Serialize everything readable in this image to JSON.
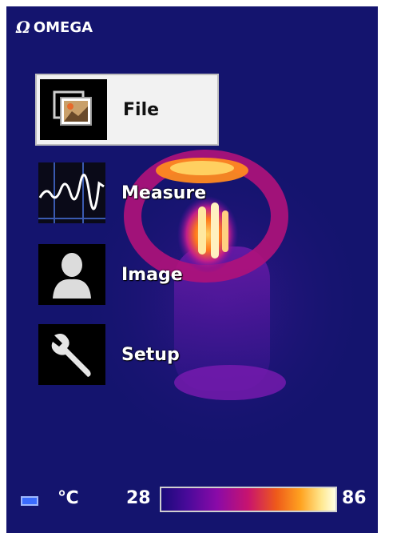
{
  "brand": {
    "symbol": "Ω",
    "name": "OMEGA"
  },
  "menu": {
    "items": [
      {
        "label": "File",
        "icon": "photos-icon",
        "selected": true
      },
      {
        "label": "Measure",
        "icon": "waveform-icon",
        "selected": false
      },
      {
        "label": "Image",
        "icon": "person-icon",
        "selected": false
      },
      {
        "label": "Setup",
        "icon": "wrench-icon",
        "selected": false
      }
    ]
  },
  "status": {
    "unit": "℃",
    "scale_min": "28",
    "scale_max": "86"
  },
  "colors": {
    "background": "#14146e",
    "selected_bg": "#f2f2f2",
    "battery": "#3b6cff"
  }
}
